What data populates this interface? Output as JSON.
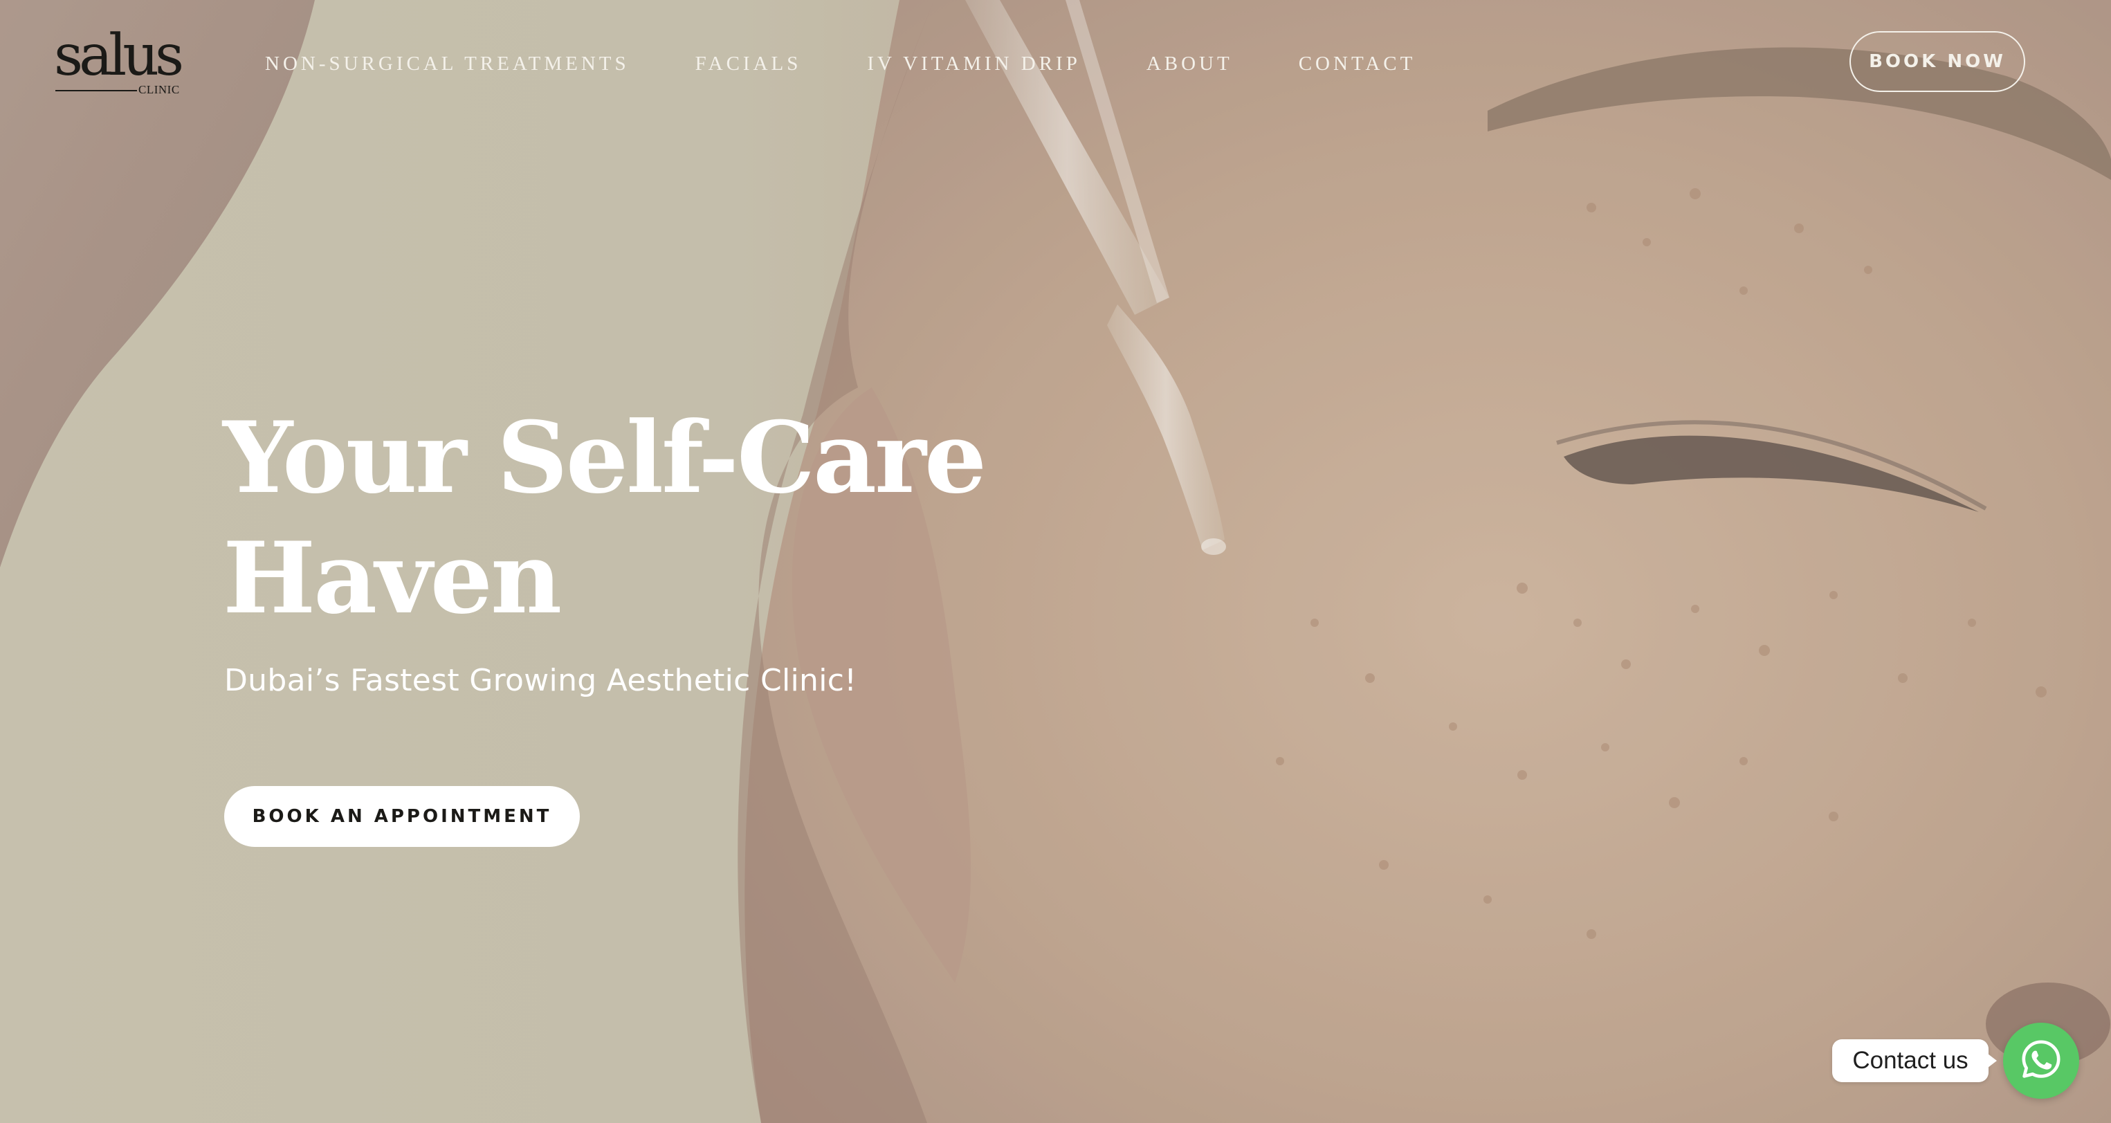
{
  "brand": {
    "logo_word": "salus",
    "logo_sub": "CLINIC"
  },
  "nav": {
    "items": [
      {
        "label": "NON-SURGICAL TREATMENTS"
      },
      {
        "label": "FACIALS"
      },
      {
        "label": "IV VITAMIN DRIP"
      },
      {
        "label": "ABOUT"
      },
      {
        "label": "CONTACT"
      }
    ],
    "book_now_label": "BOOK NOW"
  },
  "hero": {
    "title_line_1": "Your Self-Care",
    "title_line_2": "Haven",
    "subtitle": "Dubai’s Fastest Growing Aesthetic Clinic!",
    "cta_label": "BOOK AN APPOINTMENT"
  },
  "contact_widget": {
    "label": "Contact us",
    "icon": "whatsapp-icon"
  },
  "colors": {
    "background": "#bdb7a4",
    "text_light": "#ffffff",
    "nav_text": "#f4f1ea",
    "whatsapp_green": "#58c865",
    "logo_dark": "#1b1a17"
  }
}
